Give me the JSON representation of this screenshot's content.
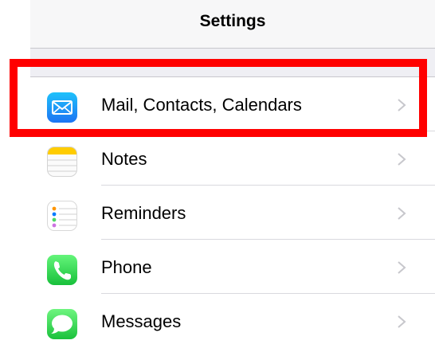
{
  "header": {
    "title": "Settings"
  },
  "settings": {
    "items": [
      {
        "label": "Mail, Contacts, Calendars",
        "icon": "mail-icon"
      },
      {
        "label": "Notes",
        "icon": "notes-icon"
      },
      {
        "label": "Reminders",
        "icon": "reminders-icon"
      },
      {
        "label": "Phone",
        "icon": "phone-icon"
      },
      {
        "label": "Messages",
        "icon": "messages-icon"
      }
    ]
  },
  "colors": {
    "highlight": "#ff0000",
    "background": "#efeff4",
    "chevron": "#c7c7cc"
  }
}
